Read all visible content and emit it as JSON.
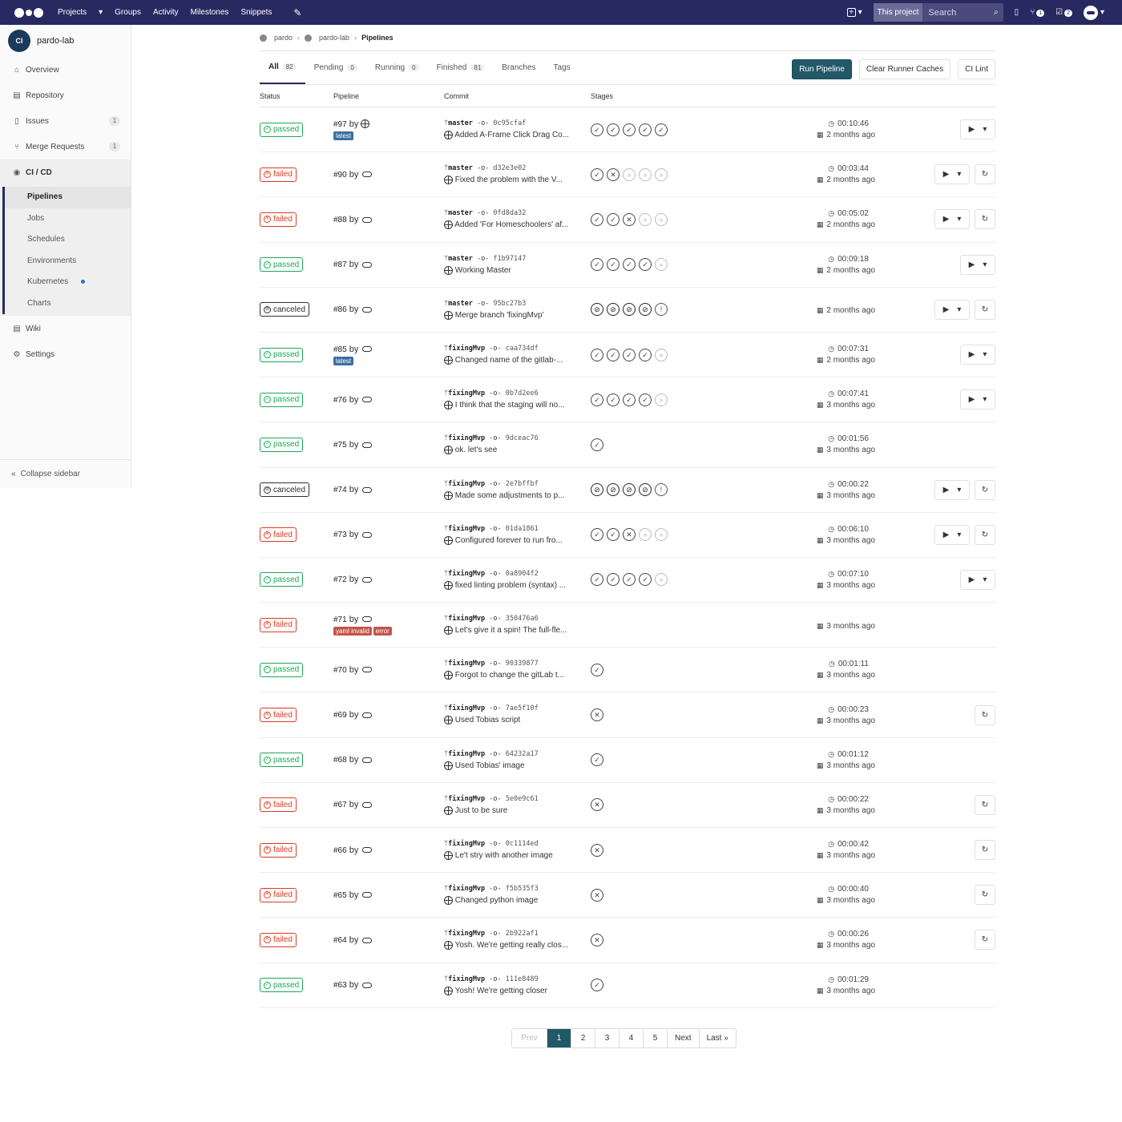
{
  "topbar": {
    "nav": [
      "Projects",
      "Groups",
      "Activity",
      "Milestones",
      "Snippets"
    ],
    "search_scope": "This project",
    "search_placeholder": "Search",
    "mr_badge": "1",
    "todo_badge": "2"
  },
  "sidebar": {
    "project_name": "pardo-lab",
    "avatar_text": "CI",
    "items": [
      {
        "label": "Overview",
        "icon": "home-icon"
      },
      {
        "label": "Repository",
        "icon": "book-icon"
      },
      {
        "label": "Issues",
        "icon": "issues-icon",
        "count": "1"
      },
      {
        "label": "Merge Requests",
        "icon": "merge-request-icon",
        "count": "1"
      }
    ],
    "cicd_label": "CI / CD",
    "cicd_sub": [
      "Pipelines",
      "Jobs",
      "Schedules",
      "Environments",
      "Kubernetes",
      "Charts"
    ],
    "after": [
      {
        "label": "Wiki",
        "icon": "book-icon"
      },
      {
        "label": "Settings",
        "icon": "gear-icon"
      }
    ],
    "collapse_label": "Collapse sidebar"
  },
  "breadcrumb": [
    "pardo",
    "pardo-lab",
    "Pipelines"
  ],
  "tabs": [
    {
      "label": "All",
      "count": "82"
    },
    {
      "label": "Pending",
      "count": "0"
    },
    {
      "label": "Running",
      "count": "0"
    },
    {
      "label": "Finished",
      "count": "81"
    },
    {
      "label": "Branches",
      "count": ""
    },
    {
      "label": "Tags",
      "count": ""
    }
  ],
  "actions": {
    "run": "Run Pipeline",
    "clear": "Clear Runner Caches",
    "lint": "CI Lint"
  },
  "headers": {
    "status": "Status",
    "pipeline": "Pipeline",
    "commit": "Commit",
    "stages": "Stages"
  },
  "rows": [
    {
      "status": "passed",
      "id": "#97",
      "tags": [
        "latest"
      ],
      "branch": "master",
      "sha": "0c95cfaf",
      "msg": "Added A-Frame Click Drag Co...",
      "stages": "PPPPP",
      "dur": "00:10:46",
      "ago": "2 months ago",
      "play": true,
      "retry": false,
      "user_globe": true
    },
    {
      "status": "failed",
      "id": "#90",
      "tags": [],
      "branch": "master",
      "sha": "d32e3e02",
      "msg": "Fixed the problem with the V...",
      "stages": "PFSSS",
      "dur": "00:03:44",
      "ago": "2 months ago",
      "play": true,
      "retry": true
    },
    {
      "status": "failed",
      "id": "#88",
      "tags": [],
      "branch": "master",
      "sha": "0fd8da32",
      "msg": "Added 'For Homeschoolers' af...",
      "stages": "PPFSS",
      "dur": "00:05:02",
      "ago": "2 months ago",
      "play": true,
      "retry": true
    },
    {
      "status": "passed",
      "id": "#87",
      "tags": [],
      "branch": "master",
      "sha": "f1b97147",
      "msg": "Working Master",
      "stages": "PPPPS",
      "dur": "00:09:18",
      "ago": "2 months ago",
      "play": true,
      "retry": false
    },
    {
      "status": "canceled",
      "id": "#86",
      "tags": [],
      "branch": "master",
      "sha": "95bc27b3",
      "msg": "Merge branch 'fixingMvp'",
      "stages": "CCCCM",
      "dur": "",
      "ago": "2 months ago",
      "play": true,
      "retry": true
    },
    {
      "status": "passed",
      "id": "#85",
      "tags": [
        "latest"
      ],
      "branch": "fixingMvp",
      "sha": "caa734df",
      "msg": "Changed name of the gitlab-...",
      "stages": "PPPPS",
      "dur": "00:07:31",
      "ago": "2 months ago",
      "play": true,
      "retry": false
    },
    {
      "status": "passed",
      "id": "#76",
      "tags": [],
      "branch": "fixingMvp",
      "sha": "0b7d2ee6",
      "msg": "I think that the staging will no...",
      "stages": "PPPPS",
      "dur": "00:07:41",
      "ago": "3 months ago",
      "play": true,
      "retry": false
    },
    {
      "status": "passed",
      "id": "#75",
      "tags": [],
      "branch": "fixingMvp",
      "sha": "9dceac76",
      "msg": "ok. let's see",
      "stages": "P",
      "dur": "00:01:56",
      "ago": "3 months ago",
      "play": false,
      "retry": false
    },
    {
      "status": "canceled",
      "id": "#74",
      "tags": [],
      "branch": "fixingMvp",
      "sha": "2e7bffbf",
      "msg": "Made some adjustments to p...",
      "stages": "CCCCM",
      "dur": "00:00:22",
      "ago": "3 months ago",
      "play": true,
      "retry": true
    },
    {
      "status": "failed",
      "id": "#73",
      "tags": [],
      "branch": "fixingMvp",
      "sha": "01da1861",
      "msg": "Configured forever to run fro...",
      "stages": "PPFSS",
      "dur": "00:06:10",
      "ago": "3 months ago",
      "play": true,
      "retry": true
    },
    {
      "status": "passed",
      "id": "#72",
      "tags": [],
      "branch": "fixingMvp",
      "sha": "0a8904f2",
      "msg": "fixed linting problem (syntax) ...",
      "stages": "PPPPS",
      "dur": "00:07:10",
      "ago": "3 months ago",
      "play": true,
      "retry": false
    },
    {
      "status": "failed",
      "id": "#71",
      "tags": [
        "yaml invalid",
        "error"
      ],
      "branch": "fixingMvp",
      "sha": "350476a6",
      "msg": "Let's give it a spin! The full-fle...",
      "stages": "",
      "dur": "",
      "ago": "3 months ago",
      "play": false,
      "retry": false
    },
    {
      "status": "passed",
      "id": "#70",
      "tags": [],
      "branch": "fixingMvp",
      "sha": "90339877",
      "msg": "Forgot to change the gitLab t...",
      "stages": "P",
      "dur": "00:01:11",
      "ago": "3 months ago",
      "play": false,
      "retry": false
    },
    {
      "status": "failed",
      "id": "#69",
      "tags": [],
      "branch": "fixingMvp",
      "sha": "7ae5f10f",
      "msg": "Used Tobias script",
      "stages": "F",
      "dur": "00:00:23",
      "ago": "3 months ago",
      "play": false,
      "retry": true
    },
    {
      "status": "passed",
      "id": "#68",
      "tags": [],
      "branch": "fixingMvp",
      "sha": "64232a17",
      "msg": "Used Tobias' image",
      "stages": "P",
      "dur": "00:01:12",
      "ago": "3 months ago",
      "play": false,
      "retry": false
    },
    {
      "status": "failed",
      "id": "#67",
      "tags": [],
      "branch": "fixingMvp",
      "sha": "5e0e9c61",
      "msg": "Just to be sure",
      "stages": "F",
      "dur": "00:00:22",
      "ago": "3 months ago",
      "play": false,
      "retry": true
    },
    {
      "status": "failed",
      "id": "#66",
      "tags": [],
      "branch": "fixingMvp",
      "sha": "0c1114ed",
      "msg": "Le't stry with another image",
      "stages": "F",
      "dur": "00:00:42",
      "ago": "3 months ago",
      "play": false,
      "retry": true
    },
    {
      "status": "failed",
      "id": "#65",
      "tags": [],
      "branch": "fixingMvp",
      "sha": "f5b535f3",
      "msg": "Changed python image",
      "stages": "F",
      "dur": "00:00:40",
      "ago": "3 months ago",
      "play": false,
      "retry": true
    },
    {
      "status": "failed",
      "id": "#64",
      "tags": [],
      "branch": "fixingMvp",
      "sha": "2b922af1",
      "msg": "Yosh. We're getting really clos...",
      "stages": "F",
      "dur": "00:00:26",
      "ago": "3 months ago",
      "play": false,
      "retry": true
    },
    {
      "status": "passed",
      "id": "#63",
      "tags": [],
      "branch": "fixingMvp",
      "sha": "111e8489",
      "msg": "Yosh! We're getting closer",
      "stages": "P",
      "dur": "00:01:29",
      "ago": "3 months ago",
      "play": false,
      "retry": false
    }
  ],
  "pagination": [
    "Prev",
    "1",
    "2",
    "3",
    "4",
    "5",
    "Next",
    "Last »"
  ],
  "colors": {
    "topbar": "#292961",
    "passed": "#1aaa55",
    "failed": "#db3b21",
    "primary_button": "#215968"
  }
}
